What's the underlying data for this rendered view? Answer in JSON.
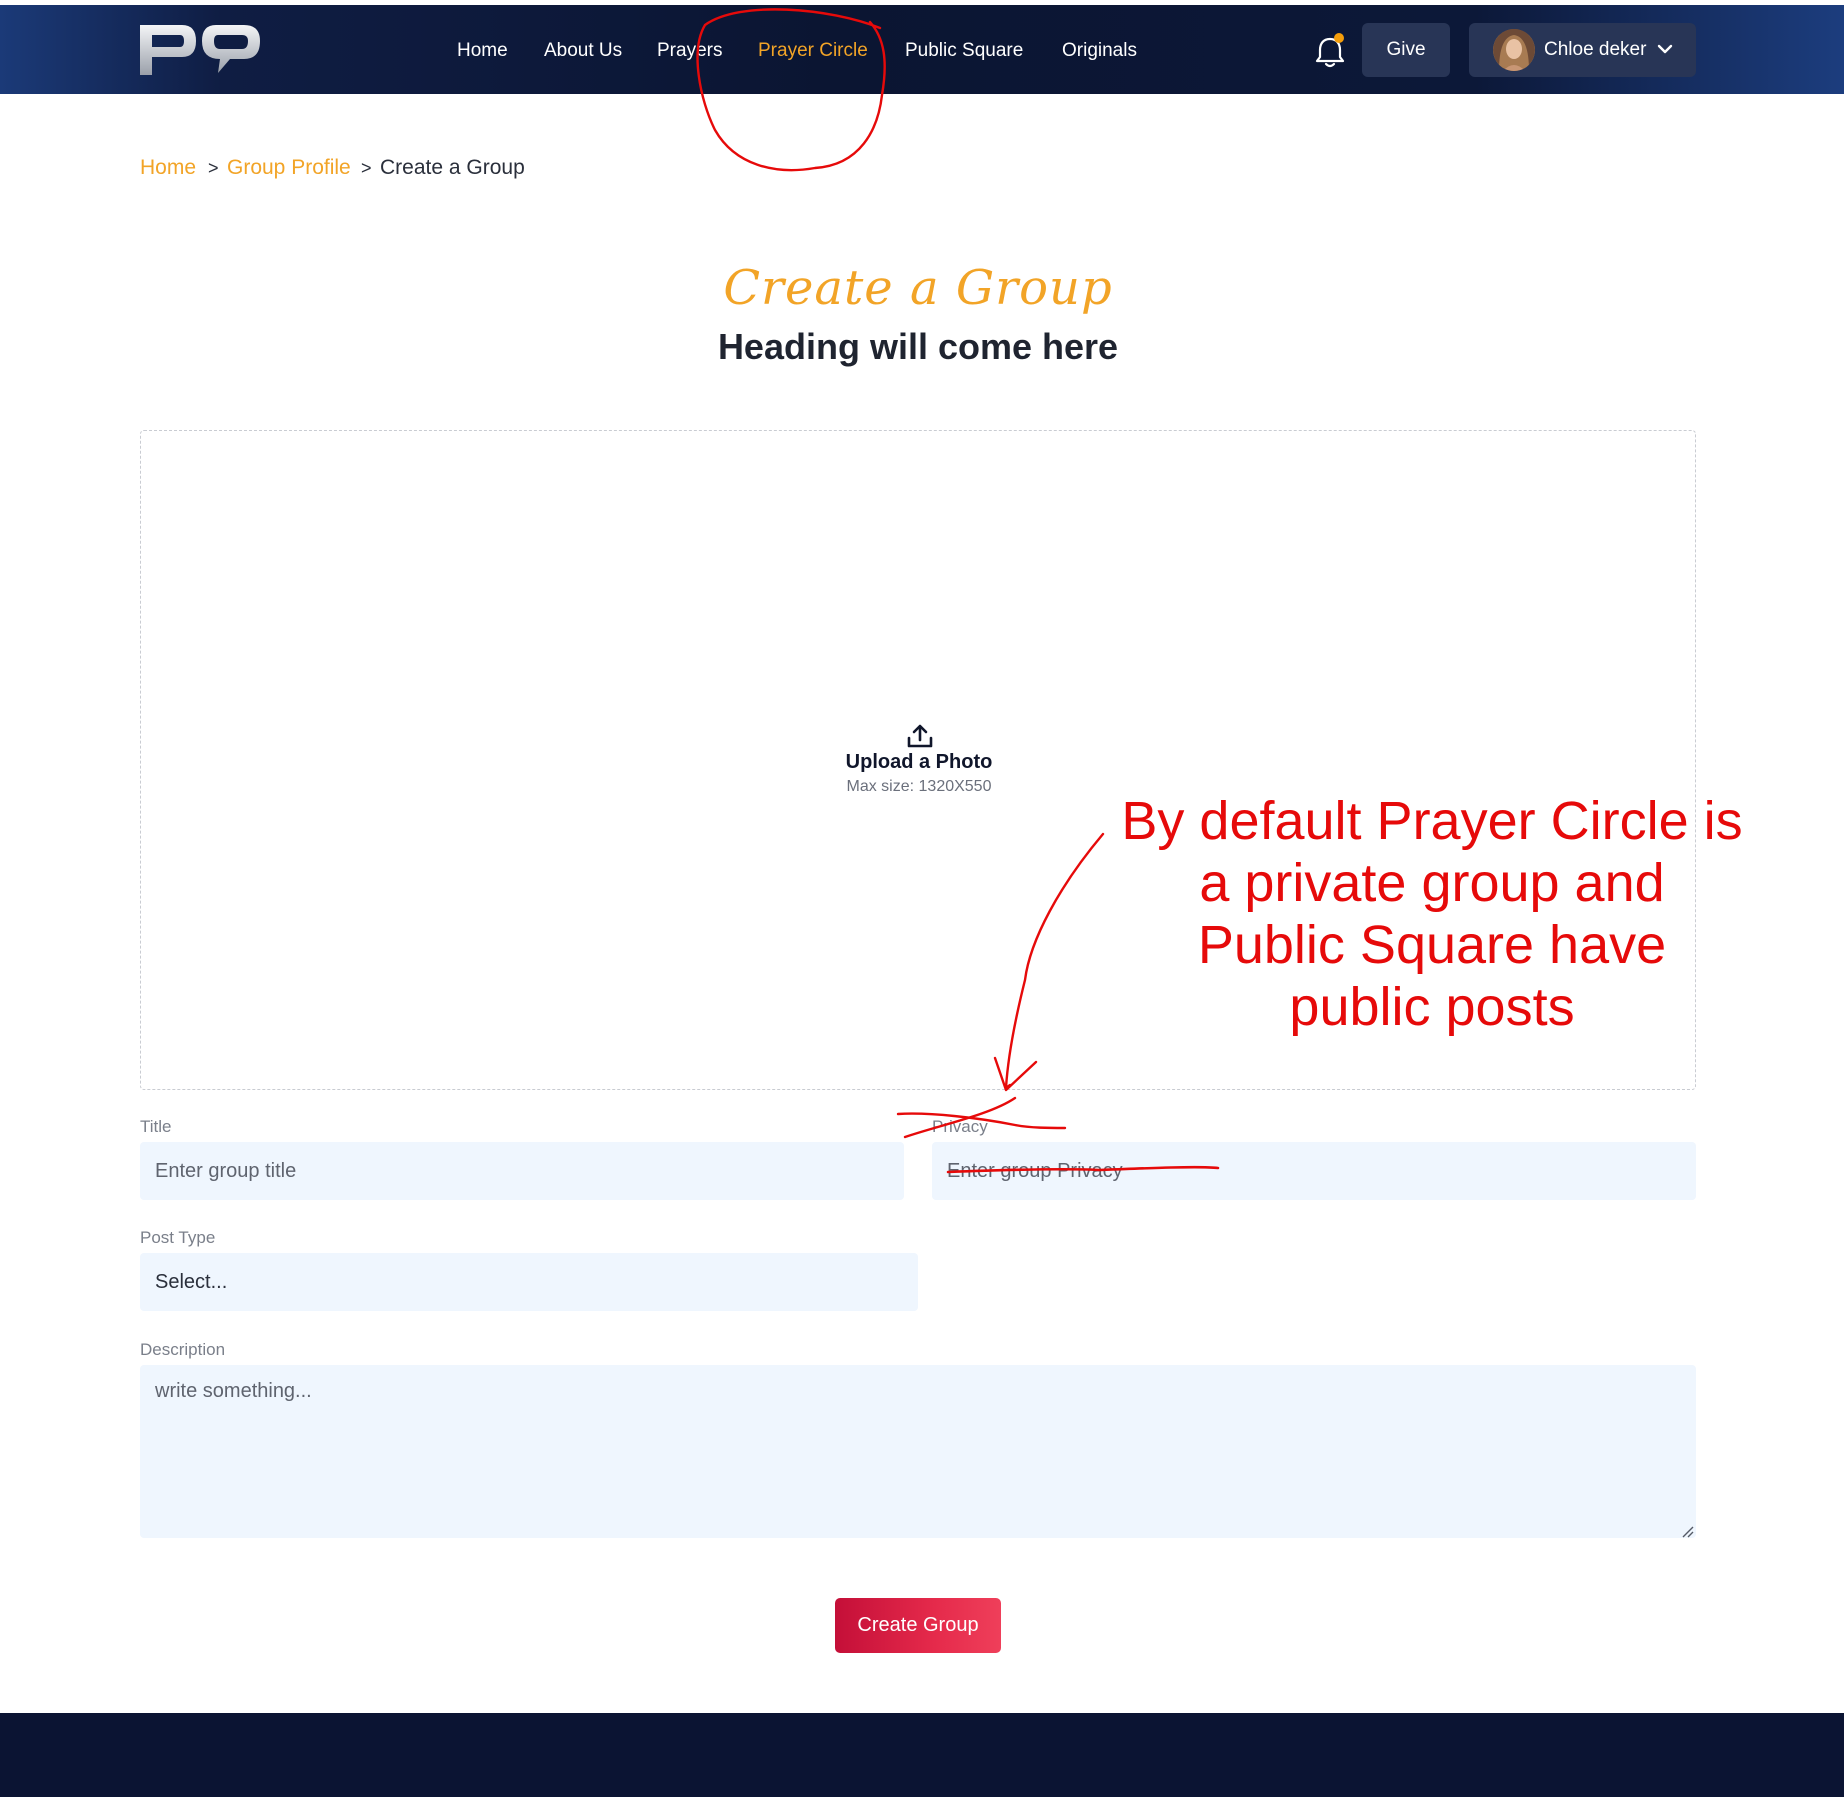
{
  "header": {
    "logo_text": "PQ",
    "nav": [
      {
        "label": "Home",
        "active": false
      },
      {
        "label": "About Us",
        "active": false
      },
      {
        "label": "Prayers",
        "active": false
      },
      {
        "label": "Prayer Circle",
        "active": true
      },
      {
        "label": "Public Square",
        "active": false
      },
      {
        "label": "Originals",
        "active": false
      }
    ],
    "notification_icon": "bell-icon",
    "notification_dot_color": "#f59e0b",
    "give_label": "Give",
    "user_name": "Chloe deker",
    "user_menu_icon": "chevron-down-icon"
  },
  "breadcrumb": {
    "items": [
      "Home",
      "Group Profile",
      "Create a Group"
    ],
    "separator": ">"
  },
  "page": {
    "script_title": "Create a Group",
    "heading": "Heading will come here"
  },
  "upload": {
    "icon": "upload-icon",
    "label": "Upload a Photo",
    "hint": "Max size: 1320X550"
  },
  "form": {
    "title_label": "Title",
    "title_placeholder": "Enter group title",
    "privacy_label": "Privacy",
    "privacy_placeholder": "Enter group Privacy",
    "post_type_label": "Post Type",
    "post_type_value": "Select...",
    "description_label": "Description",
    "description_placeholder": "write something...",
    "submit_label": "Create Group"
  },
  "annotation": {
    "lines": [
      "By default Prayer Circle is",
      "a private group and",
      "Public Square have",
      "public posts"
    ],
    "color": "#e60a0a"
  },
  "colors": {
    "accent": "#f2a427",
    "header_bg": "#0b1532",
    "field_bg": "#eff6fe",
    "button_red": "#d81b41",
    "footer_bg": "#0b1433"
  }
}
